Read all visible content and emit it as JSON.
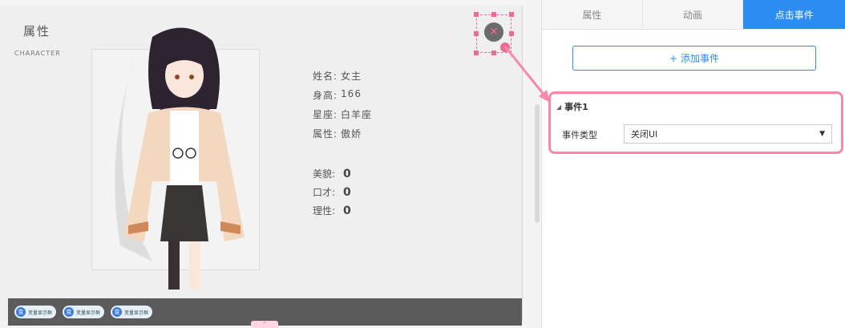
{
  "card": {
    "title": "属性",
    "subtitle": "CHARACTER",
    "info": [
      {
        "label": "姓名:",
        "value": "女主"
      },
      {
        "label": "身高:",
        "value": "166"
      },
      {
        "label": "星座:",
        "value": "白羊座"
      },
      {
        "label": "属性:",
        "value": "傲娇"
      }
    ],
    "stats": [
      {
        "label": "美貌:",
        "value": "0"
      },
      {
        "label": "口才:",
        "value": "0"
      },
      {
        "label": "理性:",
        "value": "0"
      }
    ]
  },
  "bottom_chips": [
    {
      "icon": "变",
      "label": "变量显示框"
    },
    {
      "icon": "变",
      "label": "变量显示框"
    },
    {
      "icon": "变",
      "label": "变量显示框"
    }
  ],
  "close_icon_glyph": "✕",
  "collapse_glyph": "⌃",
  "tabs": [
    {
      "label": "属性",
      "active": false
    },
    {
      "label": "动画",
      "active": false
    },
    {
      "label": "点击事件",
      "active": true
    }
  ],
  "add_event": {
    "icon": "+",
    "label": "添加事件"
  },
  "event": {
    "title": "事件1",
    "type_label": "事件类型",
    "type_value": "关闭UI",
    "arrow_glyph": "▼"
  },
  "colors": {
    "accent": "#2d8cf0",
    "highlight_pink": "#ee6a94"
  }
}
